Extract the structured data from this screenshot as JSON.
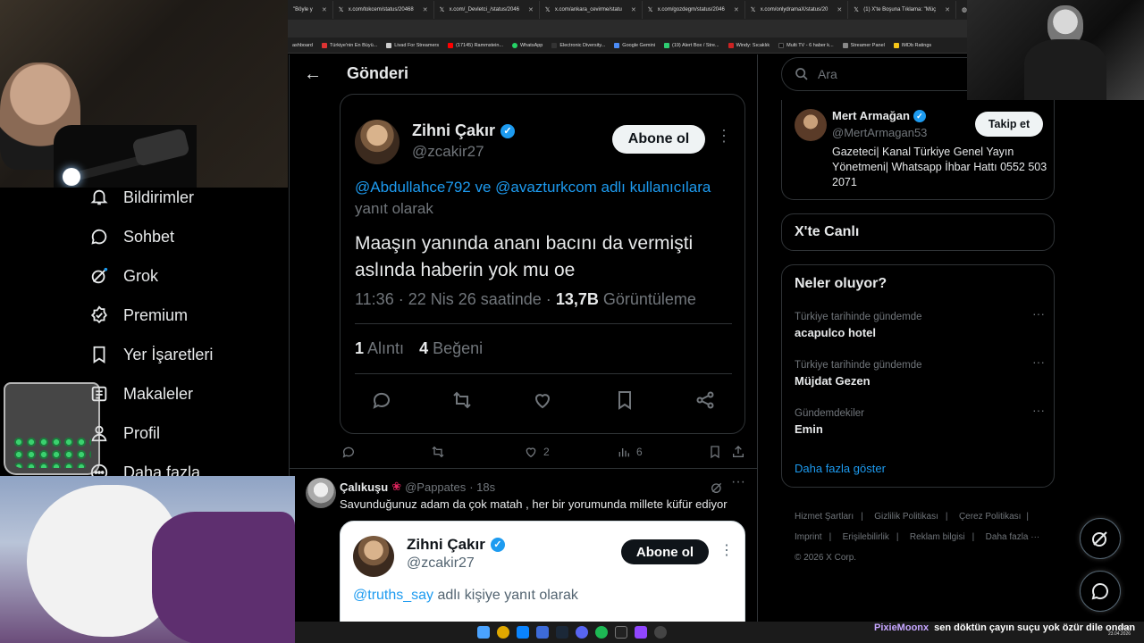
{
  "browser": {
    "tabs": [
      {
        "label": "\"Böyle y"
      },
      {
        "label": "x.com/tokcem/status/20468"
      },
      {
        "label": "x.com/_Devletci_/status/2046"
      },
      {
        "label": "x.com/ankara_cevirme/statu"
      },
      {
        "label": "x.com/gozdegm/status/2046"
      },
      {
        "label": "x.com/onlydramaX/status/20"
      },
      {
        "label": "(1) X'te Boşuna Tıklama: \"Müç"
      },
      {
        "label": "ahu"
      }
    ],
    "bookmarks": [
      {
        "label": "ashboard"
      },
      {
        "label": "Türkiye'nin En Büyü..."
      },
      {
        "label": "Livad For Streamers"
      },
      {
        "label": "(17145) Rammstein..."
      },
      {
        "label": "WhatsApp"
      },
      {
        "label": "Electronic Diversity..."
      },
      {
        "label": "Google Gemini"
      },
      {
        "label": "(19) Alert Box / Stre..."
      },
      {
        "label": "Windy: Sıcaklık"
      },
      {
        "label": "Multi TV - 6 haber k..."
      },
      {
        "label": "Streamer Panel"
      },
      {
        "label": "IMDb Ratings"
      }
    ]
  },
  "sidebar": {
    "items": [
      {
        "label": "Bildirimler",
        "icon": "bell-icon"
      },
      {
        "label": "Sohbet",
        "icon": "chat-icon"
      },
      {
        "label": "Grok",
        "icon": "grok-icon"
      },
      {
        "label": "Premium",
        "icon": "premium-icon"
      },
      {
        "label": "Yer İşaretleri",
        "icon": "bookmark-icon"
      },
      {
        "label": "Makaleler",
        "icon": "article-icon"
      },
      {
        "label": "Profil",
        "icon": "profile-icon"
      },
      {
        "label": "Daha fazla",
        "icon": "more-icon"
      }
    ]
  },
  "center": {
    "header_title": "Gönderi",
    "quoted_tweet": {
      "name": "Zihni Çakır",
      "handle": "@zcakir27",
      "follow_label": "Abone ol",
      "reply_to_prefix": "@Abdullahce792 ve @avazturkcom adlı kullanıcılara",
      "reply_to_suffix": "yanıt olarak",
      "text": "Maaşın yanında ananı bacını da vermişti aslında haberin yok mu oe",
      "time": "11:36 · 22 Nis 26 saatinde ·",
      "views_count": "13,7B",
      "views_label": "Görüntüleme",
      "quotes_count": "1",
      "quotes_label": "Alıntı",
      "likes_count": "4",
      "likes_label": "Beğeni"
    },
    "outer_actions": {
      "likes": "2",
      "views": "6"
    },
    "reply": {
      "name": "Çalıkuşu",
      "handle": "@Pappates",
      "time": "· 18s",
      "text": "Savunduğunuz adam da çok matah , her bir yorumunda millete küfür ediyor",
      "quote": {
        "name": "Zihni Çakır",
        "handle": "@zcakir27",
        "follow_label": "Abone ol",
        "reply_to_prefix": "@truths_say",
        "reply_to_suffix": "adlı kişiye yanıt olarak"
      }
    }
  },
  "right": {
    "search_placeholder": "Ara",
    "who_to_follow": {
      "name": "Mert Armağan",
      "handle": "@MertArmagan53",
      "follow_label": "Takip et",
      "bio": "Gazeteci| Kanal Türkiye Genel Yayın Yönetmeni| Whatsapp İhbar Hattı 0552 503 2071"
    },
    "live_title": "X'te Canlı",
    "trends_title": "Neler oluyor?",
    "trends": [
      {
        "category": "Türkiye tarihinde gündemde",
        "name": "acapulco hotel"
      },
      {
        "category": "Türkiye tarihinde gündemde",
        "name": "Müjdat Gezen"
      },
      {
        "category": "Gündemdekiler",
        "name": "Emin"
      }
    ],
    "show_more": "Daha fazla göster",
    "footer": {
      "links": [
        "Hizmet Şartları",
        "Gizlilik Politikası",
        "Çerez Politikası",
        "Imprint",
        "Erişilebilirlik",
        "Reklam bilgisi",
        "Daha fazla ···"
      ],
      "copyright": "© 2026 X Corp."
    }
  },
  "overlay": {
    "chat_user": "PixieMoonx",
    "chat_message": "sen döktün çayın suçu yok özür dile ondan",
    "clock_time": "19:20",
    "clock_date": "23.04.2026"
  },
  "colors": {
    "accent": "#1d9bf0",
    "background": "#000000",
    "border": "#2f3336",
    "muted": "#71767b"
  }
}
